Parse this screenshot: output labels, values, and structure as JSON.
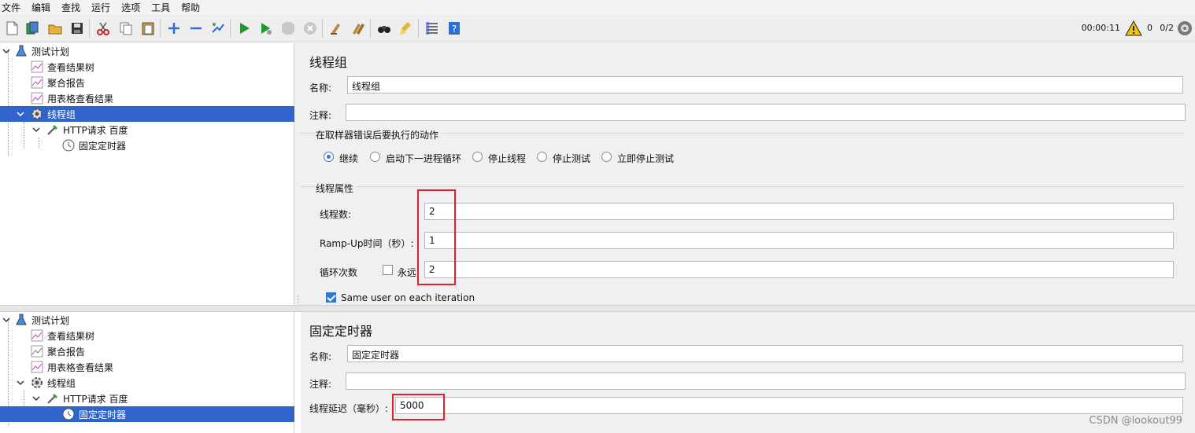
{
  "menu": [
    "文件",
    "编辑",
    "查找",
    "运行",
    "选项",
    "工具",
    "帮助"
  ],
  "toolbar": {
    "icons": [
      "new-icon",
      "templates-icon",
      "open-icon",
      "save-icon",
      "cut-icon",
      "copy-icon",
      "paste-icon",
      "expand-icon",
      "collapse-icon",
      "toggle-icon",
      "start-icon",
      "start-no-pause-icon",
      "stop-icon",
      "shutdown-icon",
      "clear-icon",
      "clear-all-icon",
      "search-icon",
      "reset-search-icon",
      "function-helper-icon",
      "help-icon"
    ],
    "elapsed": "00:00:11",
    "error_count": "0",
    "threads": "0/2"
  },
  "tree_top": {
    "nodes": [
      {
        "label": "测试计划",
        "icon": "test-plan-icon"
      },
      {
        "label": "查看结果树",
        "icon": "listener-icon"
      },
      {
        "label": "聚合报告",
        "icon": "listener-icon"
      },
      {
        "label": "用表格查看结果",
        "icon": "listener-icon"
      },
      {
        "label": "线程组",
        "icon": "thread-group-gear-icon"
      },
      {
        "label": "HTTP请求 百度",
        "icon": "sampler-pipette-icon"
      },
      {
        "label": "固定定时器",
        "icon": "timer-clock-icon"
      }
    ]
  },
  "tree_bottom": {
    "nodes": [
      {
        "label": "测试计划",
        "icon": "test-plan-icon"
      },
      {
        "label": "查看结果树",
        "icon": "listener-icon"
      },
      {
        "label": "聚合报告",
        "icon": "listener-icon"
      },
      {
        "label": "用表格查看结果",
        "icon": "listener-icon"
      },
      {
        "label": "线程组",
        "icon": "thread-group-gear-icon"
      },
      {
        "label": "HTTP请求 百度",
        "icon": "sampler-pipette-icon"
      },
      {
        "label": "固定定时器",
        "icon": "timer-clock-icon"
      }
    ]
  },
  "thread_group": {
    "title": "线程组",
    "name_label": "名称:",
    "name_value": "线程组",
    "comment_label": "注释:",
    "comment_value": "",
    "on_error_title": "在取样器错误后要执行的动作",
    "on_error_options": [
      "继续",
      "启动下一进程循环",
      "停止线程",
      "停止测试",
      "立即停止测试"
    ],
    "on_error_selected": "继续",
    "props_title": "线程属性",
    "threads_label": "线程数:",
    "threads_value": "2",
    "rampup_label": "Ramp-Up时间（秒）:",
    "rampup_value": "1",
    "loop_label": "循环次数",
    "forever_label": "永远",
    "loop_value": "2",
    "same_user_label": "Same user on each iteration"
  },
  "timer": {
    "title": "固定定时器",
    "name_label": "名称:",
    "name_value": "固定定时器",
    "comment_label": "注释:",
    "comment_value": "",
    "delay_label": "线程延迟（毫秒）:",
    "delay_value": "5000"
  },
  "watermark": "CSDN @lookout99",
  "colors": {
    "selection": "#2f65ca",
    "highlight_box": "#e1212b",
    "accent": "#2f78d8"
  }
}
